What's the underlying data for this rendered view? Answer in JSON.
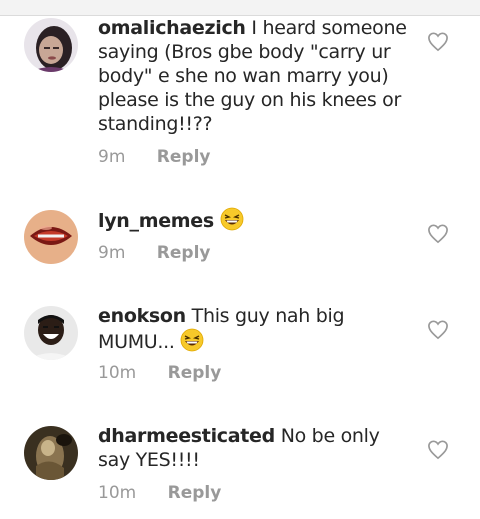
{
  "comments": [
    {
      "username": "omalichaezich",
      "text": "I heard someone saying (Bros gbe body \"carry ur body\" e she no wan marry you) please is the guy on his knees or standing!!??",
      "time": "9m",
      "reply": "Reply",
      "avatar": "avatar-girl-portrait"
    },
    {
      "username": "lyn_memes",
      "text": "",
      "emoji": "grinning-squinting-face-emoji",
      "time": "9m",
      "reply": "Reply",
      "avatar": "avatar-lips"
    },
    {
      "username": "enokson",
      "text": "This guy nah big MUMU...",
      "emoji": "grinning-squinting-face-emoji",
      "time": "10m",
      "reply": "Reply",
      "avatar": "avatar-laughing-man"
    },
    {
      "username": "dharmeesticated",
      "text": "No be only say YES!!!!",
      "time": "10m",
      "reply": "Reply",
      "avatar": "avatar-dark-figure"
    }
  ],
  "icons": {
    "like": "heart-outline-icon"
  },
  "colors": {
    "meta": "#999999",
    "text": "#262626"
  }
}
